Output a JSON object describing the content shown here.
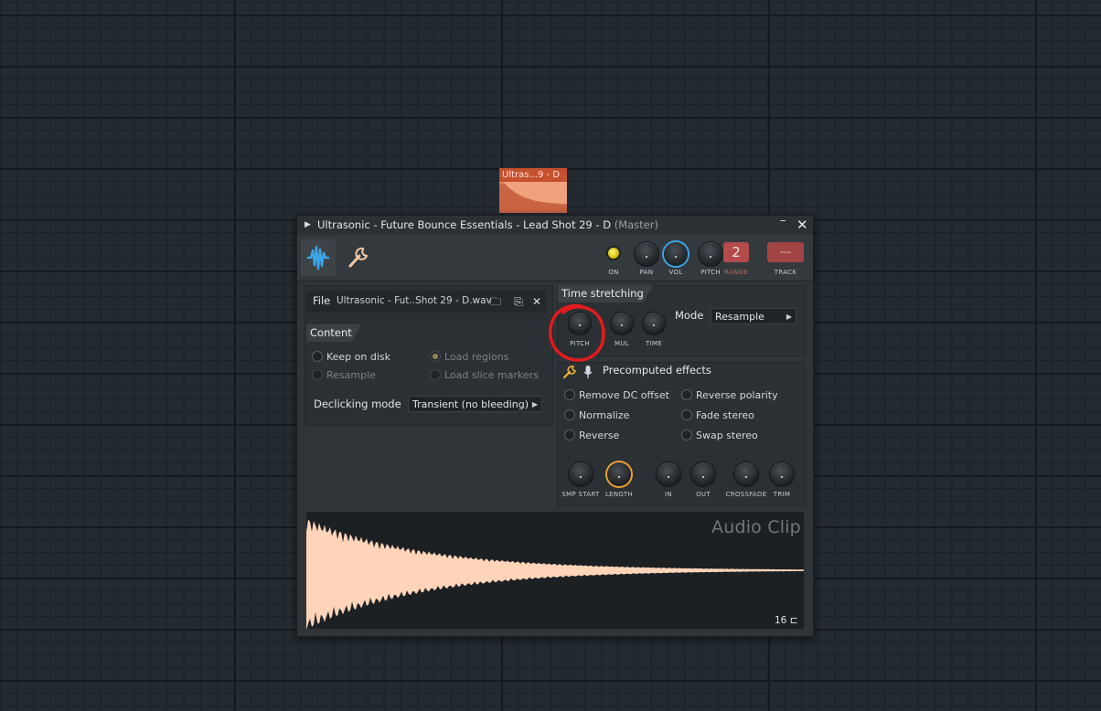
{
  "mini_clip": {
    "label": "Ultras...9 - D",
    "color": "#f0a27d"
  },
  "window": {
    "title": "Ultrasonic - Future Bounce Essentials - Lead Shot 29 - D",
    "title_suffix": "(Master)",
    "minimize_glyph": "–",
    "close_glyph": "✕"
  },
  "toolbar": {
    "tabs": [
      "waveform-icon",
      "wrench-icon"
    ],
    "knob_labels": {
      "on": "ON",
      "pan": "PAN",
      "vol": "VOL",
      "pitch": "PITCH",
      "range": "RANGE",
      "track": "TRACK"
    },
    "range_value": "2",
    "track_value": "---"
  },
  "file": {
    "label": "File",
    "name": "Ultrasonic - Fut..Shot 29 - D.wav"
  },
  "content": {
    "heading": "Content",
    "options": {
      "keep_on_disk": "Keep on disk",
      "load_regions": "Load regions",
      "resample": "Resample",
      "load_slice_markers": "Load slice markers"
    },
    "declicking_label": "Declicking mode",
    "declicking_value": "Transient (no bleeding)"
  },
  "time_stretching": {
    "heading": "Time stretching",
    "knobs": {
      "pitch": "PITCH",
      "mul": "MUL",
      "time": "TIME"
    },
    "mode_label": "Mode",
    "mode_value": "Resample"
  },
  "precomputed": {
    "heading": "Precomputed effects",
    "options": {
      "remove_dc": "Remove DC offset",
      "reverse_polarity": "Reverse polarity",
      "normalize": "Normalize",
      "fade_stereo": "Fade stereo",
      "reverse": "Reverse",
      "swap_stereo": "Swap stereo"
    },
    "knobs": {
      "smp_start": "SMP START",
      "length": "LENGTH",
      "in": "IN",
      "out": "OUT",
      "crossfade": "CROSSFADE",
      "trim": "TRIM"
    }
  },
  "waveform": {
    "label": "Audio Clip",
    "count": "16",
    "color": "#ffd4b8"
  },
  "colors": {
    "accent_blue": "#3aa6e8",
    "accent_orange": "#f0a030",
    "annotation_red": "#e21b1b"
  }
}
